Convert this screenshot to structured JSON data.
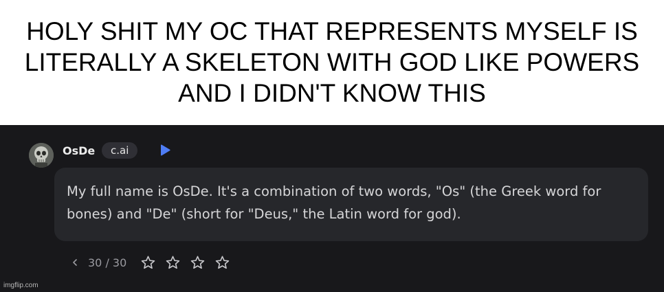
{
  "caption": {
    "text": "HOLY SHIT MY OC THAT REPRESENTS MYSELF IS LITERALLY A SKELETON WITH GOD LIKE POWERS AND I DIDN'T KNOW THIS"
  },
  "message": {
    "author_name": "OsDe",
    "author_tag": "c.ai",
    "avatar_icon": "skull-avatar-icon",
    "play_icon": "play-icon",
    "play_color": "#4f7df5",
    "text": "My full name is OsDe. It's a combination of two words, \"Os\" (the Greek word for bones) and \"De\" (short for \"Deus,\" the Latin word for god)."
  },
  "pagination": {
    "counter": "30 / 30",
    "prev_icon": "chevron-left-icon"
  },
  "rating": {
    "stars": 4,
    "selected": 0,
    "star_icon": "star-outline-icon"
  },
  "watermark": "imgflip.com",
  "colors": {
    "caption_bg": "#ffffff",
    "chat_bg": "#18181b",
    "bubble_bg": "#26272b",
    "tag_bg": "#2f2f35"
  }
}
